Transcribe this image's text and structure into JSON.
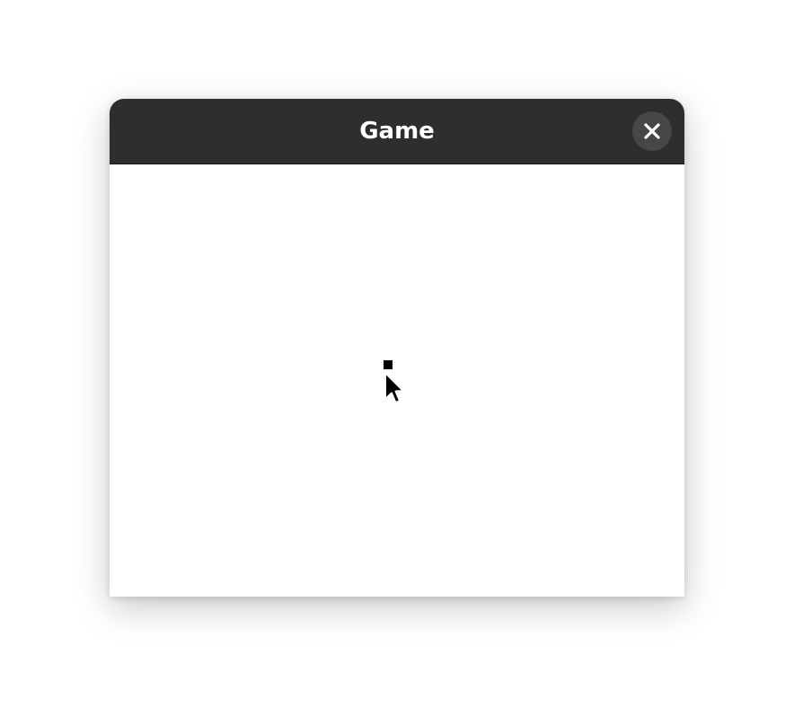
{
  "window": {
    "title": "Game"
  },
  "titlebar": {
    "close_icon": "close-icon"
  },
  "colors": {
    "titlebar_bg": "#2e2e2e",
    "close_button_bg": "#474747",
    "content_bg": "#ffffff",
    "sprite": "#000000"
  }
}
